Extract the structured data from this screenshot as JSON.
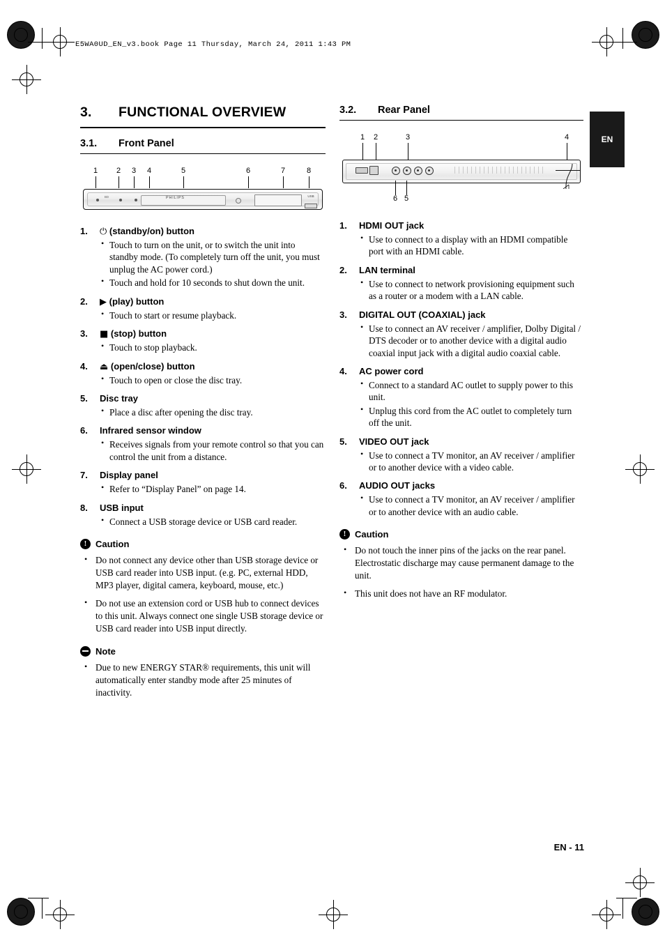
{
  "header_line": "E5WA0UD_EN_v3.book  Page 11  Thursday, March 24, 2011  1:43 PM",
  "side_tab": "EN",
  "footer": "EN - 11",
  "chapter": {
    "number": "3.",
    "title": "FUNCTIONAL OVERVIEW"
  },
  "left": {
    "section": {
      "number": "3.1.",
      "title": "Front Panel"
    },
    "figure": {
      "callout_numbers": [
        "1",
        "2",
        "3",
        "4",
        "5",
        "6",
        "7",
        "8"
      ],
      "brand": "PHILIPS",
      "usb_label": "USB"
    },
    "items": [
      {
        "num": "1.",
        "symbol": "⏻",
        "title": "(standby/on) button",
        "bullets": [
          "Touch to turn on the unit, or to switch the unit into standby mode. (To completely turn off the unit, you must unplug the AC power cord.)",
          "Touch and hold for 10 seconds to shut down the unit."
        ]
      },
      {
        "num": "2.",
        "symbol": "▶",
        "title": "(play) button",
        "bullets": [
          "Touch to start or resume playback."
        ]
      },
      {
        "num": "3.",
        "symbol": "■",
        "title": "(stop) button",
        "bullets": [
          "Touch to stop playback."
        ]
      },
      {
        "num": "4.",
        "symbol": "⏏",
        "title": "(open/close) button",
        "bullets": [
          "Touch to open or close the disc tray."
        ]
      },
      {
        "num": "5.",
        "symbol": "",
        "title": "Disc tray",
        "bullets": [
          "Place a disc after opening the disc tray."
        ]
      },
      {
        "num": "6.",
        "symbol": "",
        "title": "Infrared sensor window",
        "bullets": [
          "Receives signals from your remote control so that you can control the unit from a distance."
        ]
      },
      {
        "num": "7.",
        "symbol": "",
        "title": "Display panel",
        "bullets": [
          "Refer to “Display Panel” on page 14."
        ]
      },
      {
        "num": "8.",
        "symbol": "",
        "title": "USB input",
        "bullets": [
          "Connect a USB storage device or USB card reader."
        ]
      }
    ],
    "caution": {
      "label": "Caution",
      "icon": "caution-exclamation-icon",
      "bullets": [
        "Do not connect any device other than USB storage device or USB card reader into USB input.  (e.g. PC, external HDD, MP3 player, digital camera, keyboard, mouse, etc.)",
        "Do not use an extension cord or USB hub to connect devices to this unit. Always connect one single USB storage device or USB card reader into USB input directly."
      ]
    },
    "note": {
      "label": "Note",
      "icon": "note-icon",
      "bullets": [
        "Due to new ENERGY STAR® requirements, this unit will automatically enter standby mode after 25 minutes of inactivity."
      ]
    }
  },
  "right": {
    "section": {
      "number": "3.2.",
      "title": "Rear Panel"
    },
    "figure": {
      "callout_numbers_top": [
        "1",
        "2",
        "3",
        "4"
      ],
      "callout_numbers_bottom": [
        "6",
        "5"
      ]
    },
    "items": [
      {
        "num": "1.",
        "title": "HDMI OUT jack",
        "bullets": [
          "Use to connect to a display with an HDMI compatible port with an HDMI cable."
        ]
      },
      {
        "num": "2.",
        "title": "LAN terminal",
        "bullets": [
          "Use to connect to network provisioning equipment such as a router or a modem with a LAN cable."
        ]
      },
      {
        "num": "3.",
        "title": "DIGITAL OUT (COAXIAL) jack",
        "bullets": [
          "Use to connect an AV receiver / amplifier, Dolby Digital / DTS decoder or to another device with a digital audio coaxial input jack with a digital audio coaxial cable."
        ]
      },
      {
        "num": "4.",
        "title": "AC power cord",
        "bullets": [
          "Connect to a standard AC outlet to supply power to this unit.",
          "Unplug this cord from the AC outlet to completely turn off the unit."
        ]
      },
      {
        "num": "5.",
        "title": "VIDEO OUT jack",
        "bullets": [
          "Use to connect a TV monitor, an AV receiver / amplifier or to another device with a video cable."
        ]
      },
      {
        "num": "6.",
        "title": "AUDIO OUT jacks",
        "bullets": [
          "Use to connect a TV monitor, an AV receiver / amplifier or to another device with an audio cable."
        ]
      }
    ],
    "caution": {
      "label": "Caution",
      "icon": "caution-exclamation-icon",
      "bullets": [
        "Do not touch the inner pins of the jacks on the rear panel. Electrostatic discharge may cause permanent damage to the unit.",
        "This unit does not have an RF modulator."
      ]
    }
  }
}
